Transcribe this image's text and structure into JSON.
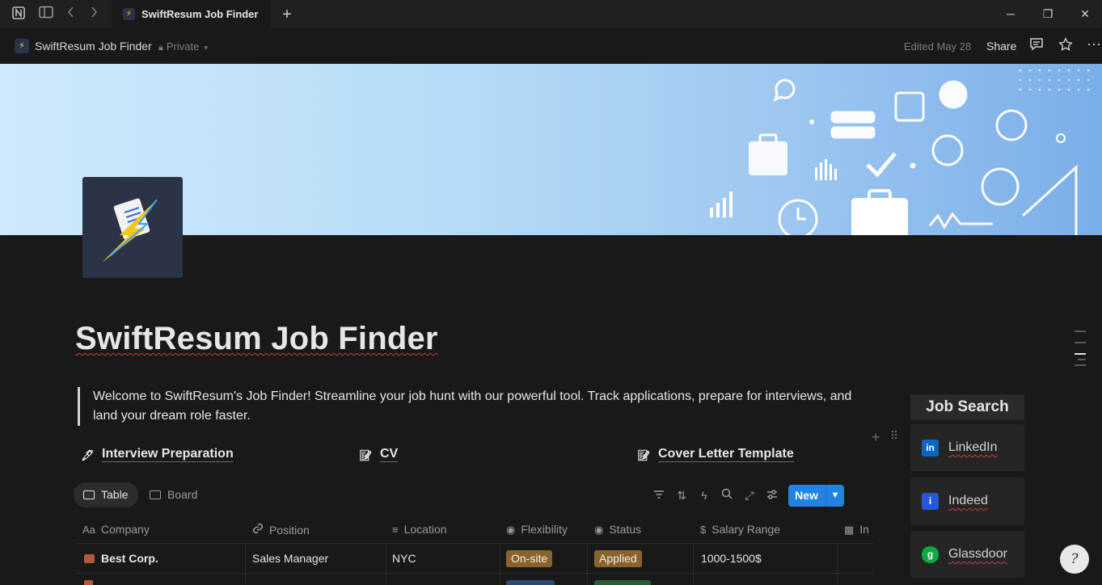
{
  "window": {
    "tab_title": "SwiftResum Job Finder",
    "new_tab": "+",
    "minimize": "─",
    "restore": "❐",
    "close": "✕"
  },
  "topbar": {
    "breadcrumb": "SwiftResum Job Finder",
    "privacy": "Private",
    "edited": "Edited May 28",
    "share": "Share"
  },
  "page": {
    "title": "SwiftResum Job Finder",
    "description": "Welcome to SwiftResum's Job Finder! Streamline your job hunt with our powerful tool. Track applications, prepare for interviews, and land your dream role faster.",
    "links": [
      {
        "icon": "pen-icon",
        "label": "Interview Preparation"
      },
      {
        "icon": "memo-icon",
        "label": "CV"
      },
      {
        "icon": "memo-icon",
        "label": "Cover Letter Template"
      }
    ]
  },
  "job_search": {
    "title": "Job Search",
    "sites": [
      {
        "label": "LinkedIn",
        "logo": "in",
        "color": "#0a66c2"
      },
      {
        "label": "Indeed",
        "logo": "i",
        "color": "#2557d6"
      },
      {
        "label": "Glassdoor",
        "logo": "g",
        "color": "#0caa41"
      }
    ]
  },
  "views": {
    "table": "Table",
    "board": "Board",
    "new": "New"
  },
  "table": {
    "columns": [
      {
        "icon": "Aa",
        "label": "Company"
      },
      {
        "icon": "🔗",
        "label": "Position"
      },
      {
        "icon": "≡",
        "label": "Location"
      },
      {
        "icon": "◉",
        "label": "Flexibility"
      },
      {
        "icon": "◉",
        "label": "Status"
      },
      {
        "icon": "$",
        "label": "Salary Range"
      },
      {
        "icon": "▦",
        "label": "In"
      }
    ],
    "rows": [
      {
        "company": "Best Corp.",
        "position": "Sales Manager",
        "location": "NYC",
        "flexibility": "On-site",
        "status": "Applied",
        "salary": "1000-1500$"
      }
    ],
    "colors": {
      "onsite": "#89632a",
      "applied": "#89632a"
    }
  },
  "help": "?"
}
